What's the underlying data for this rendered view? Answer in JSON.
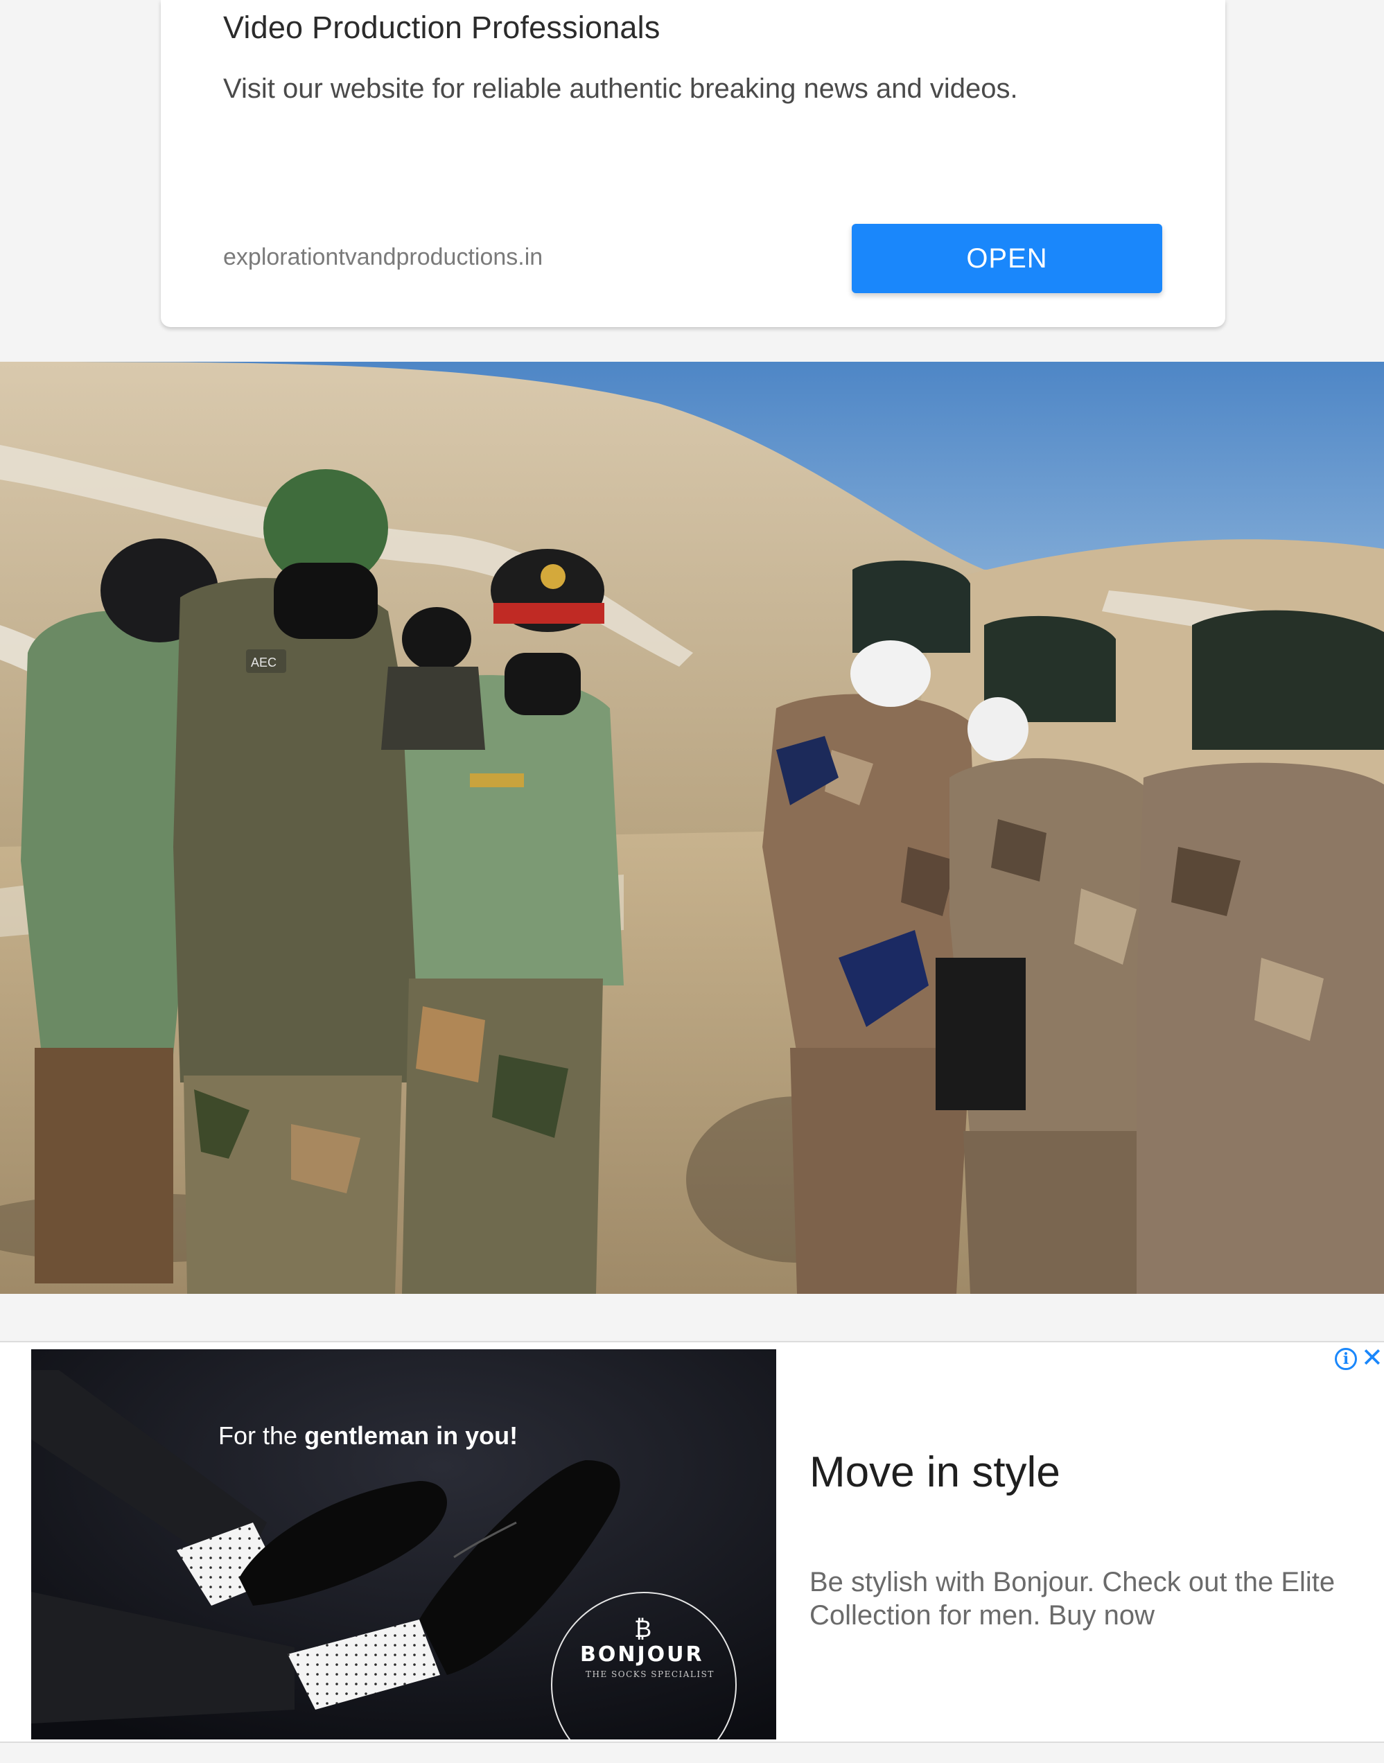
{
  "top_ad": {
    "title": "Video Production Professionals",
    "description": "Visit our website for reliable authentic breaking news and videos.",
    "domain": "explorationtvandproductions.in",
    "cta_label": "OPEN"
  },
  "news_photo": {
    "caption": "",
    "patch_text": "AEC"
  },
  "bottom_ad": {
    "tagline_prefix": "For the ",
    "tagline_bold": "gentleman in you!",
    "brand_mark": "₿",
    "brand_name": "BONJOUR",
    "brand_sub": "THE SOCKS SPECIALIST",
    "headline": "Move in style",
    "body": "Be stylish with Bonjour. Check out the Elite Collection for men. Buy now",
    "adchoices_icon": "info-icon",
    "close_icon": "close-icon"
  },
  "colors": {
    "cta_blue": "#1a87fb",
    "page_bg": "#f4f4f4"
  }
}
